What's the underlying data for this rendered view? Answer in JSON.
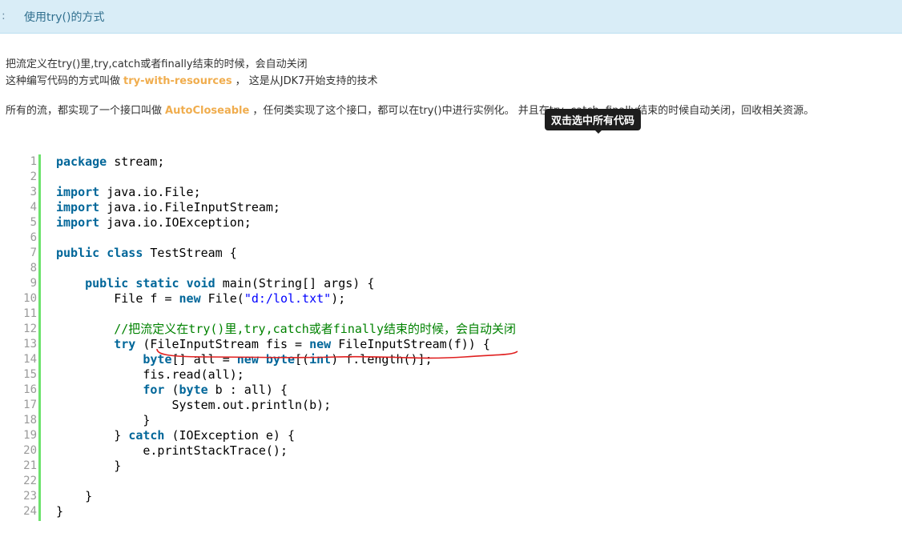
{
  "header": {
    "colon": ":",
    "title": "使用try()的方式"
  },
  "description": {
    "p1": "把流定义在try()里,try,catch或者finally结束的时候，会自动关闭",
    "p2_before": "这种编写代码的方式叫做",
    "p2_keyword": "try-with-resources",
    "p2_after": "， 这是从JDK7开始支持的技术",
    "p3_before": "所有的流，都实现了一个接口叫做",
    "p3_keyword": "AutoCloseable",
    "p3_after": "，任何类实现了这个接口，都可以在try()中进行实例化。 并且在try, catch, finally结束的时候自动关闭，回收相关资源。"
  },
  "tooltip": {
    "text": "双击选中所有代码"
  },
  "colors": {
    "header_bg": "#d9edf7",
    "header_text": "#31708f",
    "keyword_highlight": "#f0ad4e",
    "gutter_bar": "#6ce26c",
    "code_keyword": "#006699",
    "code_string": "#0000ff",
    "code_comment": "#008200",
    "annotation": "#e02020"
  },
  "code": {
    "language": "java",
    "lines": [
      [
        {
          "t": "kw",
          "v": "package"
        },
        {
          "t": "plain",
          "v": " stream;"
        }
      ],
      [],
      [
        {
          "t": "kw",
          "v": "import"
        },
        {
          "t": "plain",
          "v": " java.io.File;"
        }
      ],
      [
        {
          "t": "kw",
          "v": "import"
        },
        {
          "t": "plain",
          "v": " java.io.FileInputStream;"
        }
      ],
      [
        {
          "t": "kw",
          "v": "import"
        },
        {
          "t": "plain",
          "v": " java.io.IOException;"
        }
      ],
      [],
      [
        {
          "t": "kw",
          "v": "public"
        },
        {
          "t": "plain",
          "v": " "
        },
        {
          "t": "kw",
          "v": "class"
        },
        {
          "t": "plain",
          "v": " TestStream {"
        }
      ],
      [],
      [
        {
          "t": "plain",
          "v": "    "
        },
        {
          "t": "kw",
          "v": "public"
        },
        {
          "t": "plain",
          "v": " "
        },
        {
          "t": "kw",
          "v": "static"
        },
        {
          "t": "plain",
          "v": " "
        },
        {
          "t": "kw",
          "v": "void"
        },
        {
          "t": "plain",
          "v": " main(String[] args) {"
        }
      ],
      [
        {
          "t": "plain",
          "v": "        File f = "
        },
        {
          "t": "kw",
          "v": "new"
        },
        {
          "t": "plain",
          "v": " File("
        },
        {
          "t": "str",
          "v": "\"d:/lol.txt\""
        },
        {
          "t": "plain",
          "v": ");"
        }
      ],
      [],
      [
        {
          "t": "plain",
          "v": "        "
        },
        {
          "t": "cm",
          "v": "//把流定义在try()里,try,catch或者finally结束的时候，会自动关闭"
        }
      ],
      [
        {
          "t": "plain",
          "v": "        "
        },
        {
          "t": "kw",
          "v": "try"
        },
        {
          "t": "plain",
          "v": " (FileInputStream fis = "
        },
        {
          "t": "kw",
          "v": "new"
        },
        {
          "t": "plain",
          "v": " FileInputStream(f)) {"
        }
      ],
      [
        {
          "t": "plain",
          "v": "            "
        },
        {
          "t": "kw",
          "v": "byte"
        },
        {
          "t": "plain",
          "v": "[] all = "
        },
        {
          "t": "kw",
          "v": "new"
        },
        {
          "t": "plain",
          "v": " "
        },
        {
          "t": "kw",
          "v": "byte"
        },
        {
          "t": "plain",
          "v": "[("
        },
        {
          "t": "kw",
          "v": "int"
        },
        {
          "t": "plain",
          "v": ") f.length()];"
        }
      ],
      [
        {
          "t": "plain",
          "v": "            fis.read(all);"
        }
      ],
      [
        {
          "t": "plain",
          "v": "            "
        },
        {
          "t": "kw",
          "v": "for"
        },
        {
          "t": "plain",
          "v": " ("
        },
        {
          "t": "kw",
          "v": "byte"
        },
        {
          "t": "plain",
          "v": " b : all) {"
        }
      ],
      [
        {
          "t": "plain",
          "v": "                System.out.println(b);"
        }
      ],
      [
        {
          "t": "plain",
          "v": "            }"
        }
      ],
      [
        {
          "t": "plain",
          "v": "        } "
        },
        {
          "t": "kw",
          "v": "catch"
        },
        {
          "t": "plain",
          "v": " (IOException e) {"
        }
      ],
      [
        {
          "t": "plain",
          "v": "            e.printStackTrace();"
        }
      ],
      [
        {
          "t": "plain",
          "v": "        }"
        }
      ],
      [],
      [
        {
          "t": "plain",
          "v": "    }"
        }
      ],
      [
        {
          "t": "plain",
          "v": "}"
        }
      ]
    ]
  }
}
